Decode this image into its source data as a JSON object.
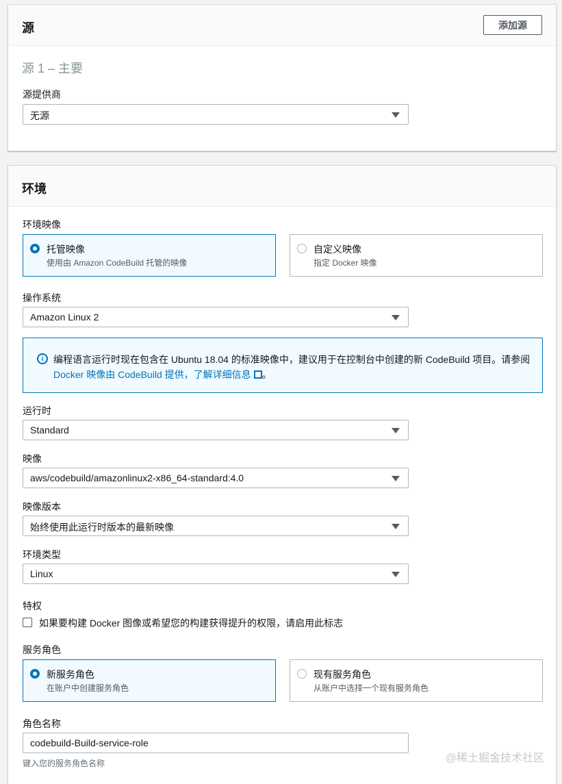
{
  "source_panel": {
    "title": "源",
    "add_button": "添加源",
    "subtitle": "源 1 – 主要",
    "provider_label": "源提供商",
    "provider_value": "无源"
  },
  "env_panel": {
    "title": "环境",
    "image_label": "环境映像",
    "image_options": [
      {
        "title": "托管映像",
        "desc": "使用由 Amazon CodeBuild 托管的映像",
        "selected": true
      },
      {
        "title": "自定义映像",
        "desc": "指定 Docker 映像",
        "selected": false
      }
    ],
    "os_label": "操作系统",
    "os_value": "Amazon Linux 2",
    "info": {
      "text": "编程语言运行时现在包含在 Ubuntu 18.04 的标准映像中，建议用于在控制台中创建的新 CodeBuild 项目。请参阅",
      "link": "Docker 映像由 CodeBuild 提供，了解详细信息",
      "suffix": "。"
    },
    "runtime_label": "运行时",
    "runtime_value": "Standard",
    "image_name_label": "映像",
    "image_name_value": "aws/codebuild/amazonlinux2-x86_64-standard:4.0",
    "image_version_label": "映像版本",
    "image_version_value": "始终使用此运行时版本的最新映像",
    "env_type_label": "环境类型",
    "env_type_value": "Linux",
    "privileged_label": "特权",
    "privileged_checkbox": "如果要构建 Docker 图像或希望您的构建获得提升的权限，请启用此标志",
    "service_role_label": "服务角色",
    "service_role_options": [
      {
        "title": "新服务角色",
        "desc": "在账户中创建服务角色",
        "selected": true
      },
      {
        "title": "现有服务角色",
        "desc": "从账户中选择一个现有服务角色",
        "selected": false
      }
    ],
    "role_name_label": "角色名称",
    "role_name_value": "codebuild-Build-service-role",
    "role_name_hint": "键入您的服务角色名称"
  },
  "watermark": "@稀土掘金技术社区",
  "colors": {
    "accent": "#0073bb",
    "border": "#aab7b8",
    "background": "#f2f3f3"
  }
}
